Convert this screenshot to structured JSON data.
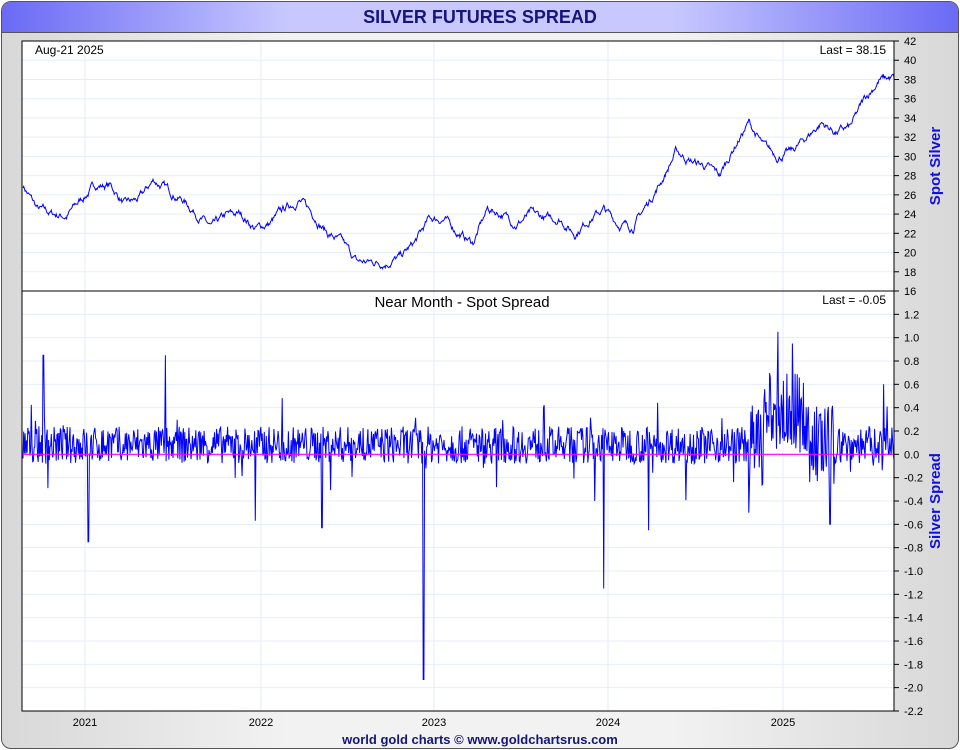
{
  "title": "SILVER FUTURES SPREAD",
  "footer": "world gold charts © www.goldchartsrus.com",
  "chart_data": [
    {
      "type": "line",
      "panel": "top",
      "title": "",
      "date_label": "Aug-21  2025",
      "last_label": "Last = 38.15",
      "ylabel": "Spot Silver",
      "ylim": [
        16,
        42
      ],
      "yticks": [
        16,
        18,
        20,
        22,
        24,
        26,
        28,
        30,
        32,
        34,
        36,
        38,
        40,
        42
      ],
      "x_start": "2020-08-21",
      "x_end": "2025-08-21",
      "xticks": [
        "2021",
        "2022",
        "2023",
        "2024",
        "2025"
      ],
      "series": [
        {
          "name": "Spot Silver",
          "color": "#0000ff",
          "monthly_values": [
            27,
            24.5,
            24,
            23.8,
            25.5,
            27,
            27,
            25,
            25.5,
            27.5,
            26.5,
            25.5,
            24,
            22.5,
            23.8,
            24,
            22.5,
            23,
            24.5,
            25.5,
            24,
            22,
            21,
            19,
            19,
            19,
            19.5,
            21,
            23.5,
            23.5,
            22,
            21,
            24.5,
            24,
            23,
            24,
            23.5,
            23.5,
            22,
            23.5,
            24.5,
            23,
            22.7,
            25,
            27.5,
            30.5,
            29.5,
            29,
            28,
            31,
            33.5,
            31,
            30,
            30.5,
            32,
            33.5,
            32.5,
            33,
            36,
            38,
            38.15
          ]
        }
      ]
    },
    {
      "type": "line",
      "panel": "bottom",
      "title": "Near Month - Spot Spread",
      "last_label": "Last = -0.05",
      "ylabel": "Silver Spread",
      "ylim": [
        -2.2,
        1.4
      ],
      "yticks": [
        -2.2,
        -2.0,
        -1.8,
        -1.6,
        -1.4,
        -1.2,
        -1.0,
        -0.8,
        -0.6,
        -0.4,
        -0.2,
        0.0,
        0.2,
        0.4,
        0.6,
        0.8,
        1.0,
        1.2,
        1.4
      ],
      "zero_line_color": "#ff00ff",
      "series": [
        {
          "name": "Spread",
          "color": "#0000ff",
          "spikes_by_month": [
            [
              1.4,
              0.85
            ],
            [
              4.5,
              -0.75
            ],
            [
              9.8,
              0.85
            ],
            [
              16,
              -0.57
            ],
            [
              20.6,
              -0.63
            ],
            [
              27.6,
              -1.93
            ],
            [
              40,
              -1.15
            ],
            [
              43.1,
              -0.65
            ],
            [
              50,
              -0.5
            ],
            [
              52,
              1.05
            ],
            [
              53,
              0.95
            ],
            [
              55.6,
              -0.6
            ],
            [
              59.3,
              0.6
            ],
            [
              60,
              -0.05
            ]
          ]
        }
      ]
    }
  ]
}
